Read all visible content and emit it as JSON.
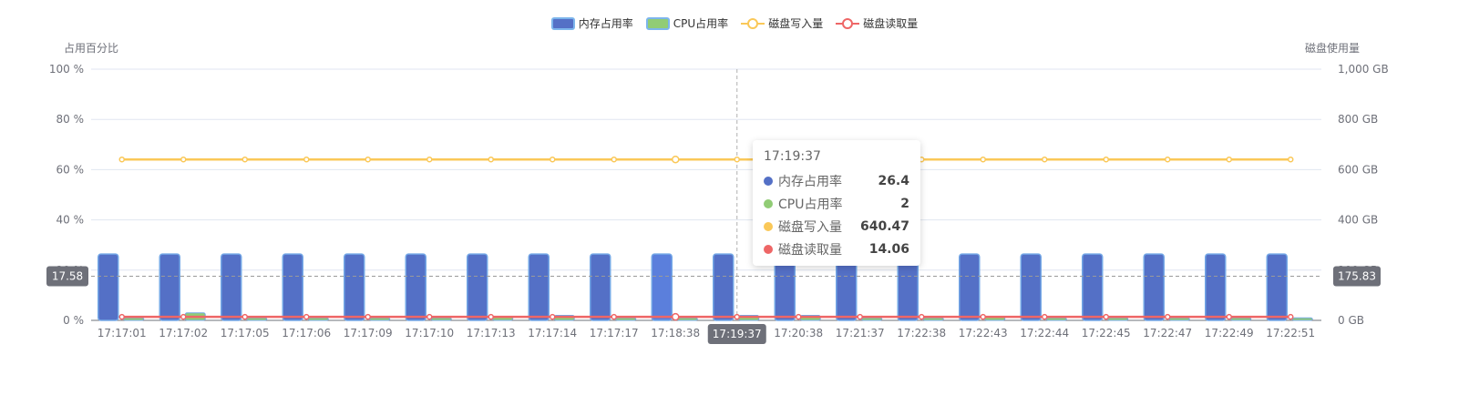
{
  "colors": {
    "memory": "#5470c6",
    "memory_highlight": "#5b7fdc",
    "memory_border": "#73a7e6",
    "cpu": "#91cc75",
    "disk_write": "#fac858",
    "disk_read": "#ee6666",
    "axis": "#6e7079",
    "grid": "#e0e6f1"
  },
  "legend": [
    {
      "name": "内存占用率",
      "kind": "bar",
      "color": "#5470c6"
    },
    {
      "name": "CPU占用率",
      "kind": "bar",
      "color": "#91cc75"
    },
    {
      "name": "磁盘写入量",
      "kind": "line",
      "color": "#fac858"
    },
    {
      "name": "磁盘读取量",
      "kind": "line",
      "color": "#ee6666"
    }
  ],
  "tooltip": {
    "title": "17:19:37",
    "rows": [
      {
        "name": "内存占用率",
        "value": "26.4",
        "color": "#5470c6"
      },
      {
        "name": "CPU占用率",
        "value": "2",
        "color": "#91cc75"
      },
      {
        "name": "磁盘写入量",
        "value": "640.47",
        "color": "#fac858"
      },
      {
        "name": "磁盘读取量",
        "value": "14.06",
        "color": "#ee6666"
      }
    ]
  },
  "crosshair": {
    "x_label": "17:19:37",
    "left_value": "17.58",
    "right_value": "175.83",
    "percent_value": 17.58
  },
  "chart_data": {
    "type": "bar",
    "categories": [
      "17:17:01",
      "17:17:02",
      "17:17:05",
      "17:17:06",
      "17:17:09",
      "17:17:10",
      "17:17:13",
      "17:17:14",
      "17:17:17",
      "17:18:38",
      "17:19:37",
      "17:20:38",
      "17:21:37",
      "17:22:38",
      "17:22:43",
      "17:22:44",
      "17:22:45",
      "17:22:47",
      "17:22:49",
      "17:22:51"
    ],
    "y_left": {
      "label": "占用百分比",
      "min": 0,
      "max": 100,
      "ticks": [
        0,
        20,
        40,
        60,
        80,
        100
      ],
      "tick_labels": [
        "0 %",
        "20 %",
        "40 %",
        "60 %",
        "80 %",
        "100 %"
      ]
    },
    "y_right": {
      "label": "磁盘使用量",
      "min": 0,
      "max": 1000,
      "ticks": [
        0,
        200,
        400,
        600,
        800,
        1000
      ],
      "tick_labels": [
        "0 GB",
        "200 GB",
        "400 GB",
        "600 GB",
        "800 GB",
        "1,000 GB"
      ]
    },
    "series": [
      {
        "name": "内存占用率",
        "type": "bar",
        "axis": "left",
        "values": [
          26.4,
          26.4,
          26.4,
          26.4,
          26.4,
          26.4,
          26.4,
          26.4,
          26.4,
          26.4,
          26.4,
          26.4,
          26.4,
          26.4,
          26.4,
          26.4,
          26.4,
          26.4,
          26.4,
          26.4
        ]
      },
      {
        "name": "CPU占用率",
        "type": "bar",
        "axis": "left",
        "values": [
          1,
          3,
          1,
          1,
          1,
          1,
          1.5,
          2,
          1,
          1,
          2,
          2,
          1,
          1,
          1.5,
          1,
          1,
          1,
          1,
          1
        ]
      },
      {
        "name": "磁盘写入量",
        "type": "line",
        "axis": "right",
        "values": [
          640.47,
          640.47,
          640.47,
          640.47,
          640.47,
          640.47,
          640.47,
          640.47,
          640.47,
          640.47,
          640.47,
          640.47,
          640.47,
          640.47,
          640.47,
          640.47,
          640.47,
          640.47,
          640.47,
          640.47
        ]
      },
      {
        "name": "磁盘读取量",
        "type": "line",
        "axis": "right",
        "values": [
          14.06,
          14.06,
          14.06,
          14.06,
          14.06,
          14.06,
          14.06,
          14.06,
          14.06,
          14.06,
          14.06,
          14.06,
          14.06,
          14.06,
          14.06,
          14.06,
          14.06,
          14.06,
          14.06,
          14.06
        ]
      }
    ],
    "highlight_index": 10,
    "grid": true,
    "legend_position": "top-center"
  }
}
